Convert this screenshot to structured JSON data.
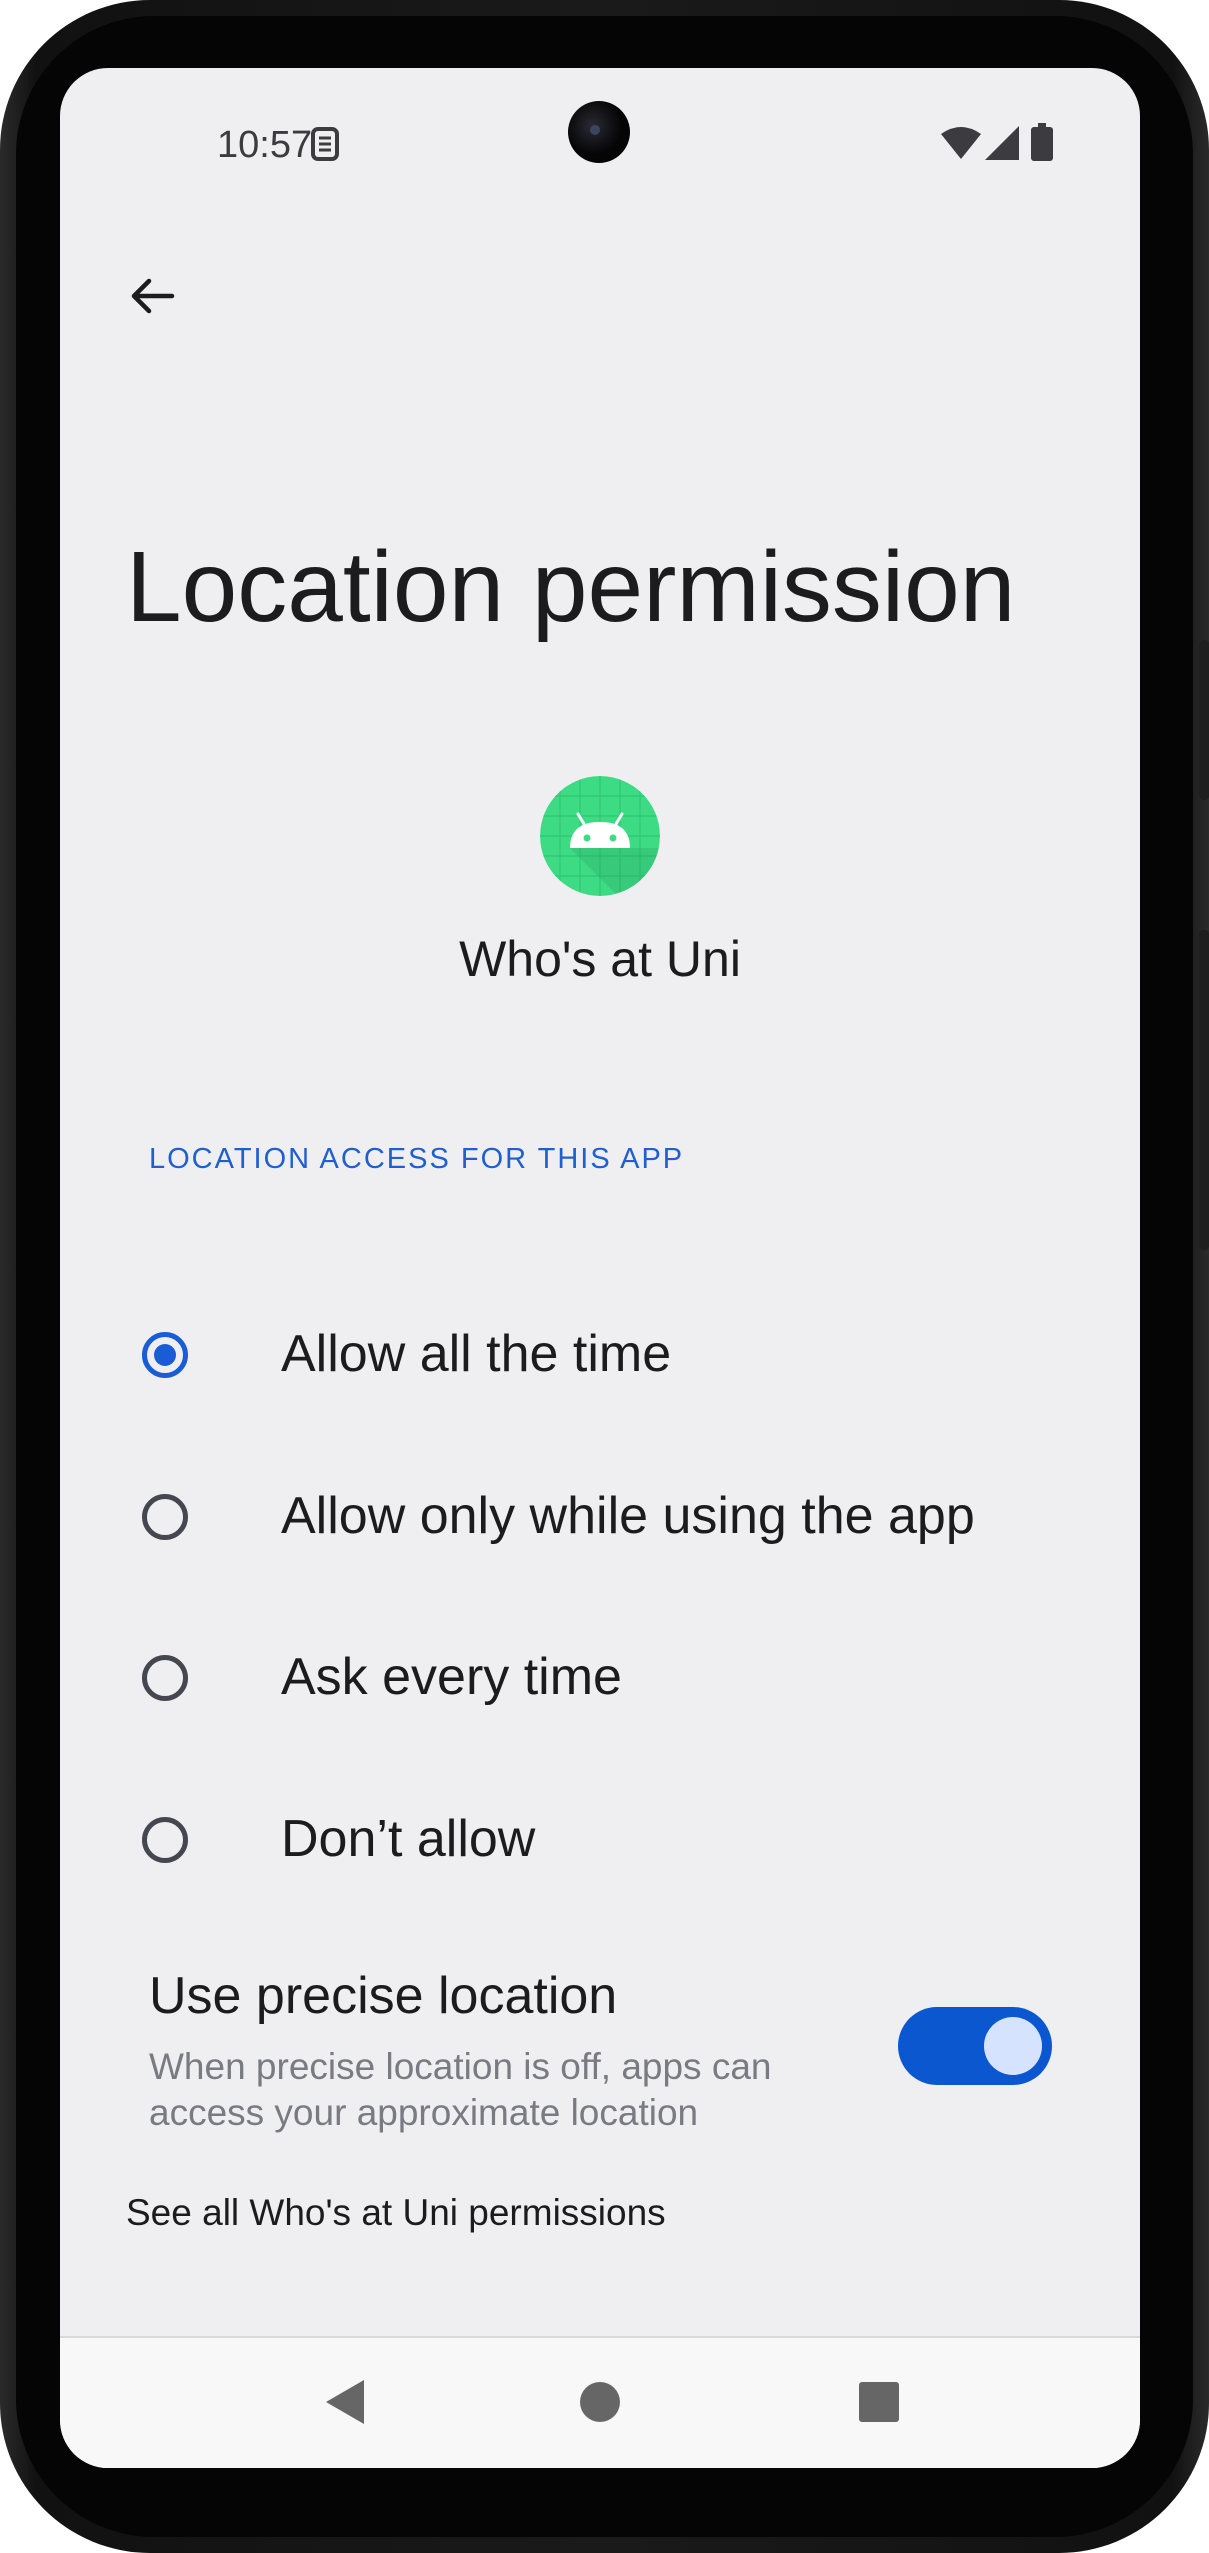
{
  "status_bar": {
    "time": "10:57",
    "icons": [
      "sim-toolkit-icon",
      "wifi-icon",
      "cellular-signal-icon",
      "battery-icon"
    ]
  },
  "header": {
    "back_icon": "arrow-back-icon",
    "title": "Location permission"
  },
  "app": {
    "icon": "android-robot-icon",
    "name": "Who's at Uni"
  },
  "section": {
    "header": "LOCATION ACCESS FOR THIS APP"
  },
  "options": [
    {
      "label": "Allow all the time",
      "selected": true
    },
    {
      "label": "Allow only while using the app",
      "selected": false
    },
    {
      "label": "Ask every time",
      "selected": false
    },
    {
      "label": "Don’t allow",
      "selected": false
    }
  ],
  "precise_location": {
    "title": "Use precise location",
    "summary": "When precise location is off, apps can access your approximate location",
    "enabled": true
  },
  "footer": {
    "see_all": "See all Who's at Uni permissions"
  },
  "navigation": {
    "back": "nav-back-icon",
    "home": "nav-home-icon",
    "recents": "nav-recents-icon"
  },
  "colors": {
    "accent": "#1a5cd6",
    "background": "#efeff2",
    "app_icon_green": "#3ddc84"
  }
}
